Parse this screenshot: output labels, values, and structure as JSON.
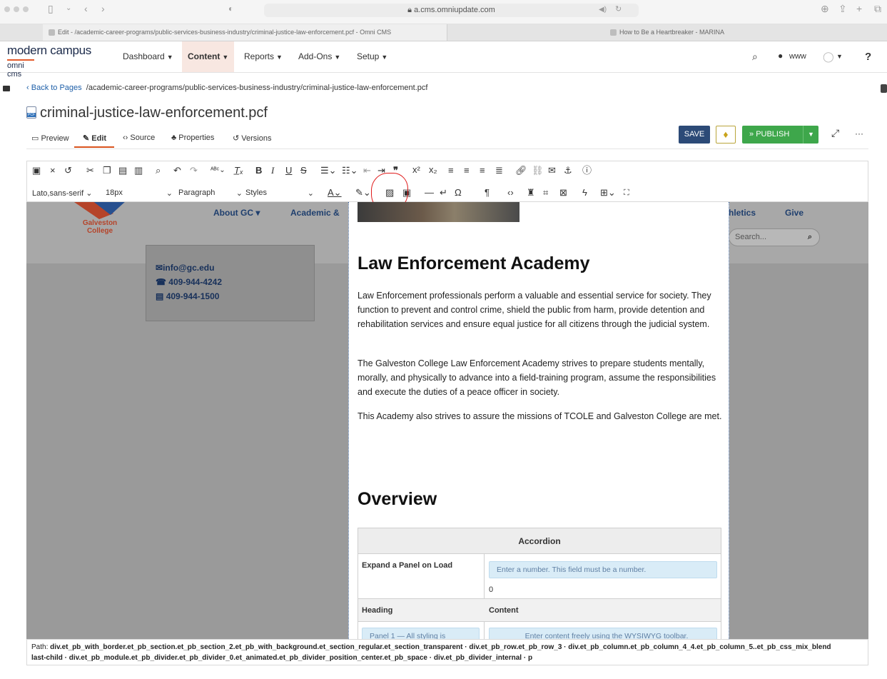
{
  "browser": {
    "address": "a.cms.omniupdate.com",
    "tabs": [
      {
        "label": "Edit - /academic-career-programs/public-services-business-industry/criminal-justice-law-enforcement.pcf - Omni CMS"
      },
      {
        "label": "How to Be a Heartbreaker - MARINA"
      }
    ]
  },
  "cms": {
    "brand": "modern campus",
    "brand_sub": "omni cms",
    "nav": [
      "Dashboard",
      "Content",
      "Reports",
      "Add-Ons",
      "Setup"
    ],
    "site_label": "www"
  },
  "page": {
    "back_label": "Back to Pages",
    "path": "/academic-career-programs/public-services-business-industry/criminal-justice-law-enforcement.pcf",
    "file_name": "criminal-justice-law-enforcement.pcf",
    "view_tabs": [
      "Preview",
      "Edit",
      "Source",
      "Properties",
      "Versions"
    ],
    "save_label": "SAVE",
    "publish_label": "PUBLISH"
  },
  "toolbar": {
    "font_family": "Lato,sans-serif",
    "font_size": "18px",
    "block_format": "Paragraph",
    "styles": "Styles"
  },
  "site": {
    "logo_text": "Galveston College",
    "nav_items": [
      "About GC",
      "Academic &",
      "thletics",
      "Give"
    ],
    "search_placeholder": "Search...",
    "contact": {
      "email": "info@gc.edu",
      "phone": "409-944-4242",
      "fax": "409-944-1500"
    }
  },
  "content": {
    "heading1": "Law Enforcement Academy",
    "paragraphs": [
      "Law Enforcement professionals perform a valuable and essential service for society. They function to prevent and control crime, shield the public from harm, provide detention and rehabilitation services and ensure equal justice for all citizens through the judicial system.",
      "The Galveston College Law Enforcement Academy strives to prepare students mentally, morally, and physically to advance into a field-training program, assume the responsibilities and execute the duties of a peace officer in society.",
      "This Academy also strives to assure the missions of TCOLE and Galveston College are met."
    ],
    "heading2": "Overview",
    "accordion": {
      "title": "Accordion",
      "expand_label": "Expand a Panel on Load",
      "expand_hint": "Enter a number. This field must be a number.",
      "expand_value": "0",
      "col_heading": "Heading",
      "col_content": "Content",
      "panel_hint": "Panel 1 — All styling is",
      "content_hint": "Enter content freely using the WYSIWYG toolbar."
    }
  },
  "status_path": {
    "label": "Path:",
    "line1": "div.et_pb_with_border.et_pb_section.et_pb_section_2.et_pb_with_background.et_section_regular.et_section_transparent · div.et_pb_row.et_pb_row_3 · div.et_pb_column.et_pb_column_4_4.et_pb_column_5..et_pb_css_mix_blend",
    "line2": "last-child · div.et_pb_module.et_pb_divider.et_pb_divider_0.et_animated.et_pb_divider_position_center.et_pb_space · div.et_pb_divider_internal · p"
  }
}
